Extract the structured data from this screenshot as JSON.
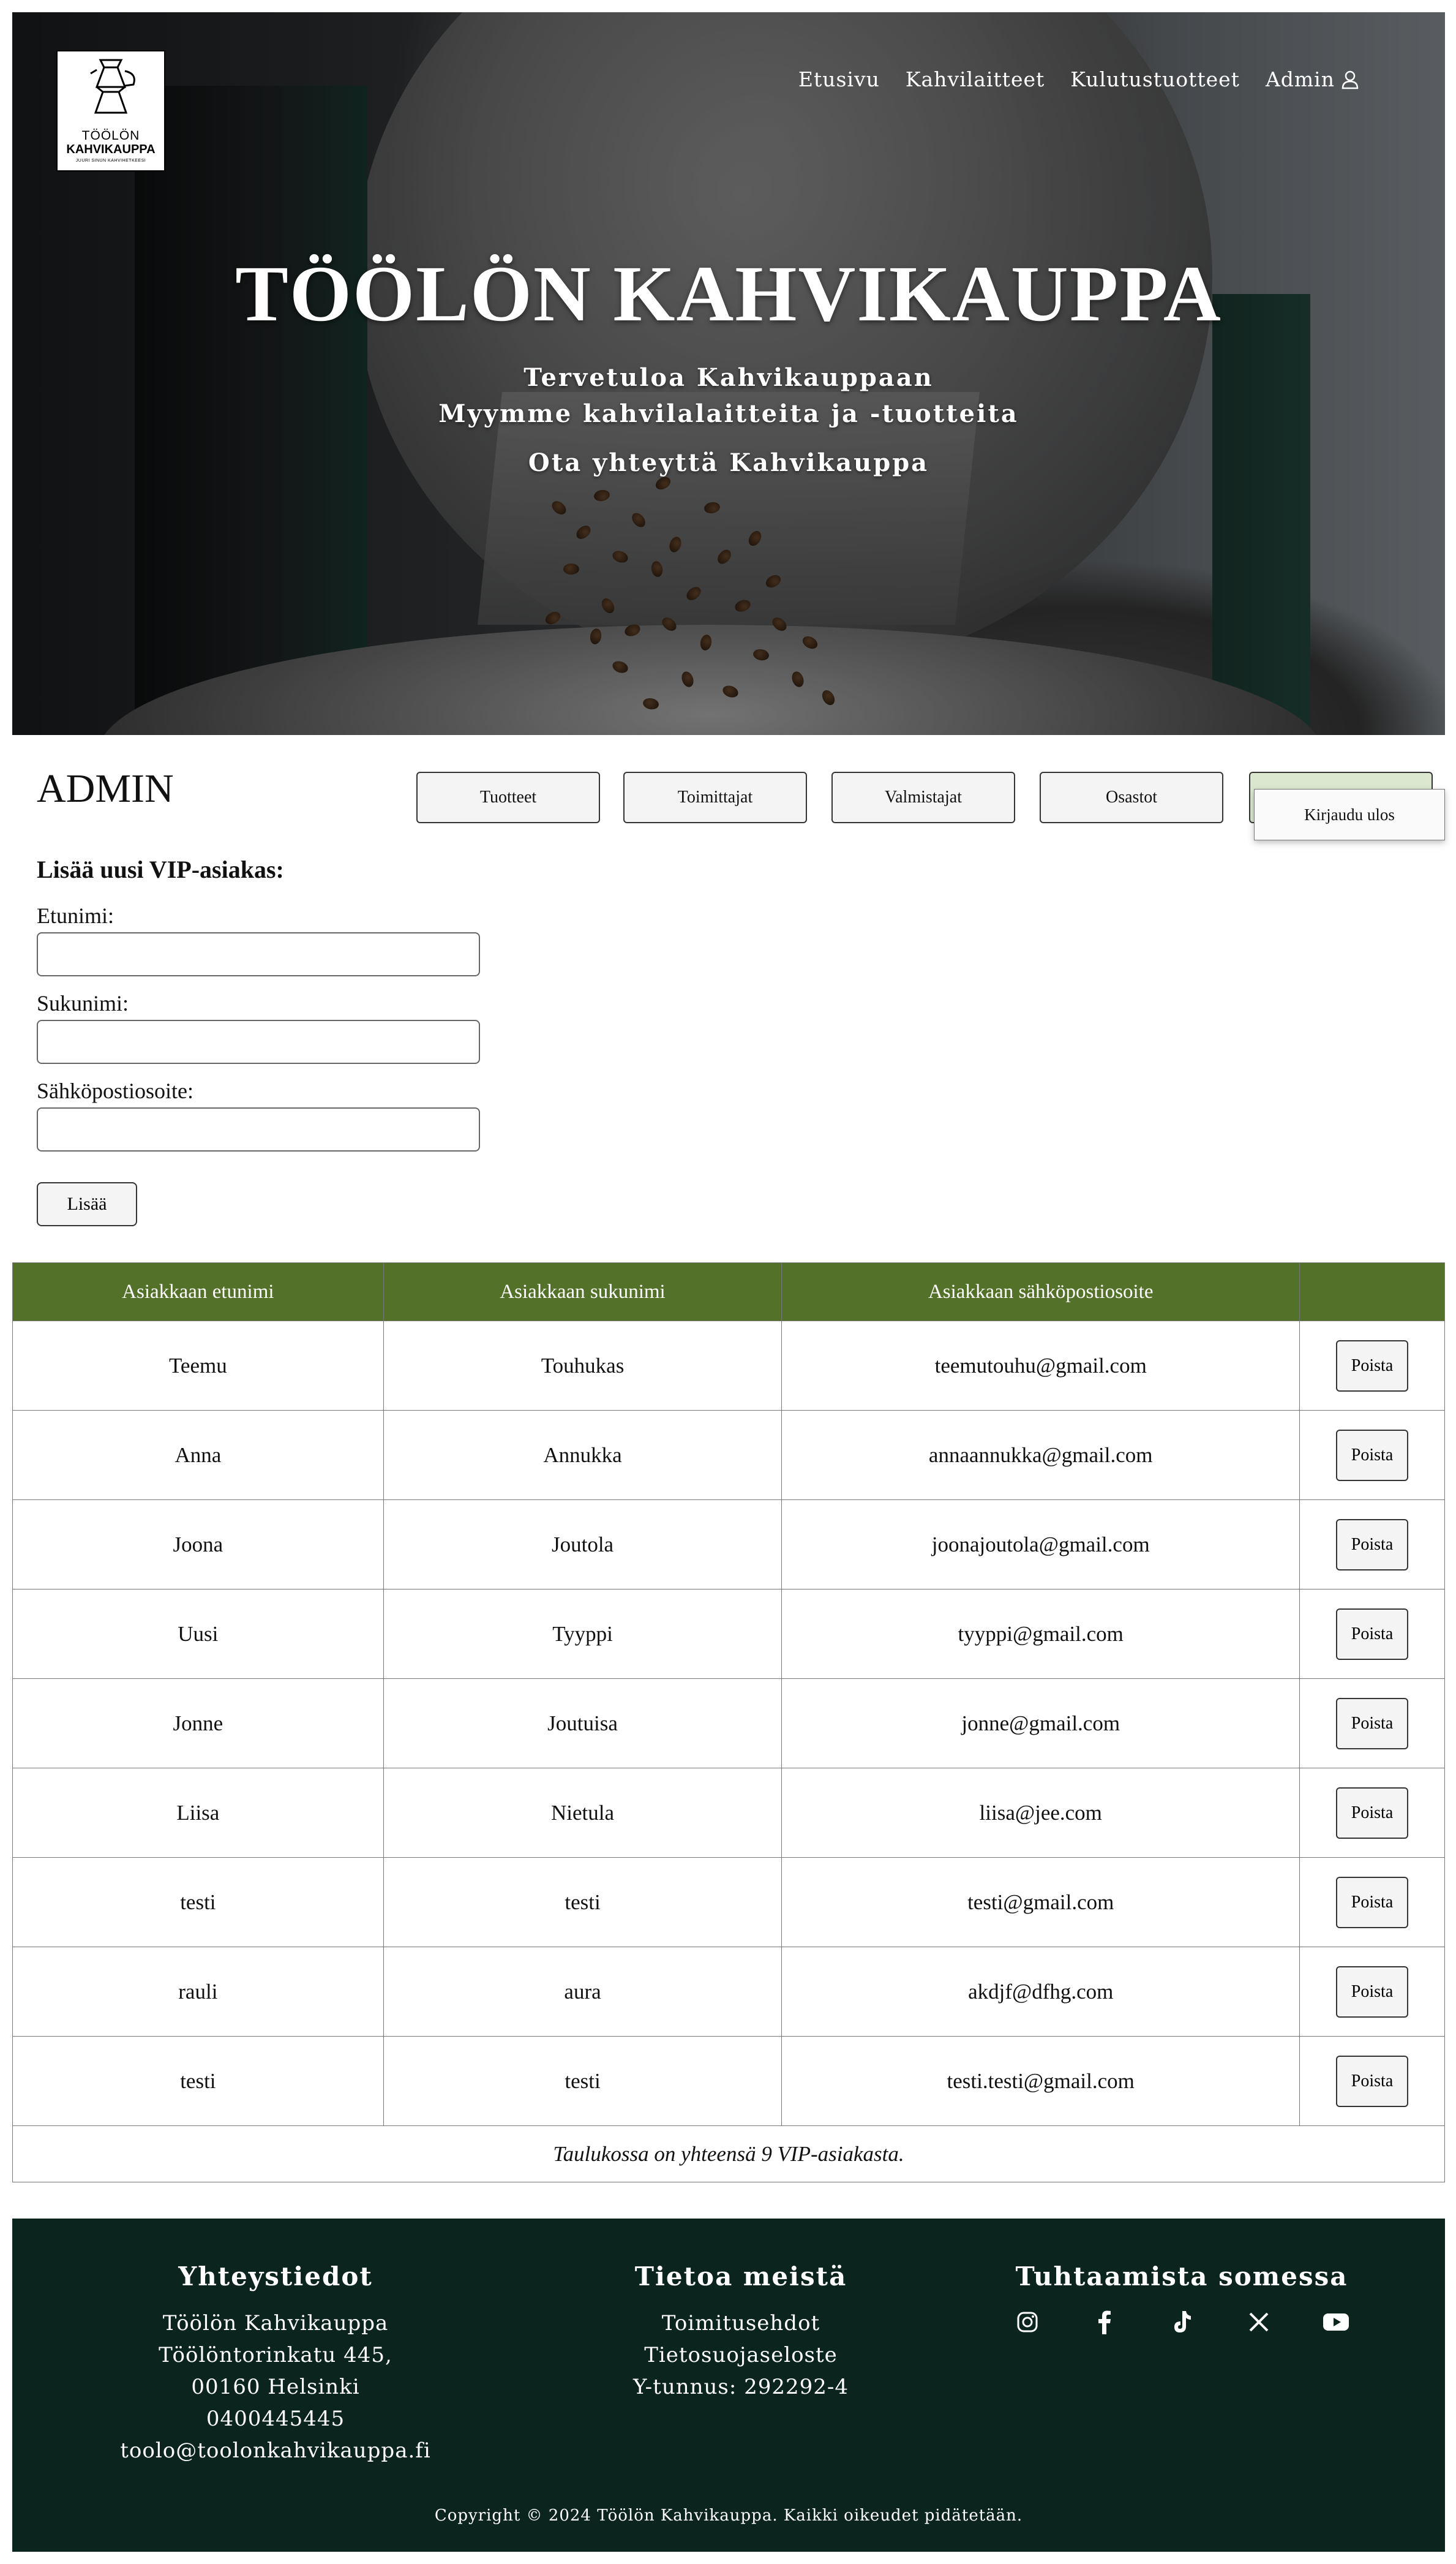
{
  "header": {
    "logo": {
      "line1": "TÖÖLÖN",
      "line2": "KAHVIKAUPPA",
      "line3": "JUURI SINUN KAHVIHETKEESI"
    },
    "nav": [
      "Etusivu",
      "Kahvilaitteet",
      "Kulutustuotteet",
      "Admin"
    ],
    "title": "TÖÖLÖN KAHVIKAUPPA",
    "subtitle1": "Tervetuloa Kahvikauppaan",
    "subtitle2": "Myymme kahvilalaitteita ja -tuotteita",
    "subtitle3": "Ota yhteyttä Kahvikauppa"
  },
  "admin": {
    "title": "ADMIN",
    "buttons": [
      "Tuotteet",
      "Toimittajat",
      "Valmistajat",
      "Osastot",
      ""
    ],
    "logout": "Kirjaudu ulos"
  },
  "form": {
    "heading": "Lisää uusi VIP-asiakas:",
    "firstname_label": "Etunimi:",
    "lastname_label": "Sukunimi:",
    "email_label": "Sähköpostiosoite:",
    "submit": "Lisää"
  },
  "table": {
    "headers": [
      "Asiakkaan etunimi",
      "Asiakkaan sukunimi",
      "Asiakkaan sähköpostiosoite",
      ""
    ],
    "delete_label": "Poista",
    "rows": [
      {
        "first": "Teemu",
        "last": "Touhukas",
        "email": "teemutouhu@gmail.com"
      },
      {
        "first": "Anna",
        "last": "Annukka",
        "email": "annaannukka@gmail.com"
      },
      {
        "first": "Joona",
        "last": "Joutola",
        "email": "joonajoutola@gmail.com"
      },
      {
        "first": "Uusi",
        "last": "Tyyppi",
        "email": "tyyppi@gmail.com"
      },
      {
        "first": "Jonne",
        "last": "Joutuisa",
        "email": "jonne@gmail.com"
      },
      {
        "first": "Liisa",
        "last": "Nietula",
        "email": "liisa@jee.com"
      },
      {
        "first": "testi",
        "last": "testi",
        "email": "testi@gmail.com"
      },
      {
        "first": "rauli",
        "last": "aura",
        "email": "akdjf@dfhg.com"
      },
      {
        "first": "testi",
        "last": "testi",
        "email": "testi.testi@gmail.com"
      }
    ],
    "caption": "Taulukossa on yhteensä 9 VIP-asiakasta."
  },
  "footer": {
    "contact_title": "Yhteystiedot",
    "contact_lines": [
      "Töölön Kahvikauppa",
      "Töölöntorinkatu 445,",
      "00160 Helsinki",
      "0400445445",
      "toolo@toolonkahvikauppa.fi"
    ],
    "about_title": "Tietoa meistä",
    "about_lines": [
      "Toimitusehdot",
      "Tietosuojaseloste",
      "Y-tunnus: 292292-4"
    ],
    "social_title": "Tuhtaamista somessa",
    "social_icons": [
      "instagram-icon",
      "facebook-icon",
      "tiktok-icon",
      "x-icon",
      "youtube-icon"
    ],
    "copyright": "Copyright © 2024 Töölön Kahvikauppa. Kaikki oikeudet pidätetään."
  }
}
